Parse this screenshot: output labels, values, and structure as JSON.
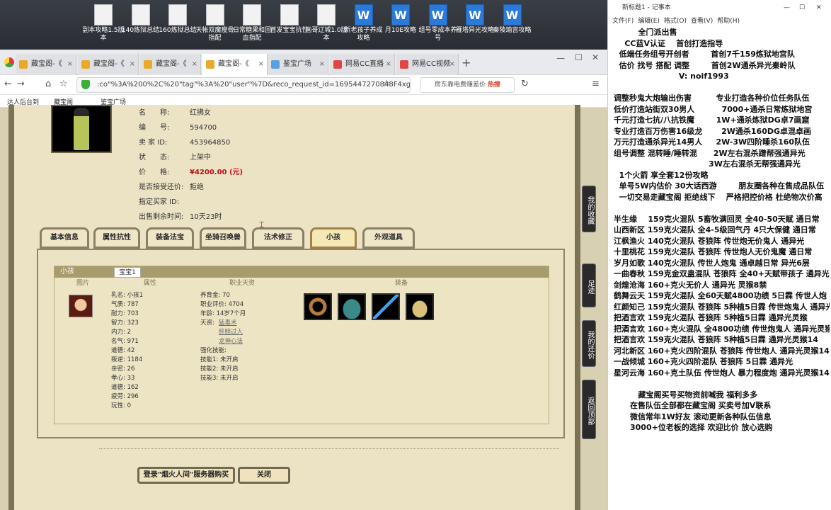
{
  "desktop": {
    "icons": [
      "副本攻略1.5版本",
      "140炼狱总结",
      "160炼狱总结",
      "天帐双魔瘦骨指配",
      "日常糖果和回血指配",
      "首发宝宝抗性",
      "画哥辽城1.0版本",
      "新老孩子养成攻略",
      "月10E攻略",
      "组号零成本养号",
      "雁塔异光攻略",
      "秦陵瑜宫攻略"
    ]
  },
  "browser": {
    "tabs": [
      {
        "label": "藏宝阁-《"
      },
      {
        "label": "藏宝阁-《"
      },
      {
        "label": "藏宝阁-《"
      },
      {
        "label": "藏宝阁-《"
      },
      {
        "label": "鉴宝广场"
      },
      {
        "label": "网易CC直播"
      },
      {
        "label": "网易CC视频"
      }
    ],
    "url": ":co\"%3A%200%2C%20\"tag\"%3A%20\"user\"%7D&reco_request_id=1695447270848F4xg6",
    "search_text": "房东靠电费赚差价",
    "search_hot": "热搜",
    "bookmarks": [
      "达人后台到",
      "藏宝阁",
      "鉴宝广场"
    ]
  },
  "detail": {
    "rows": [
      {
        "k": "名　　称:",
        "v": "红拂女"
      },
      {
        "k": "编　　号:",
        "v": "594700"
      },
      {
        "k": "卖 家 ID:",
        "v": "453964850"
      },
      {
        "k": "状　　态:",
        "v": "上架中"
      },
      {
        "k": "价　　格:",
        "v": "¥4200.00 (元)"
      },
      {
        "k": "是否接受还价:",
        "v": "拒绝"
      },
      {
        "k": "指定买家 ID:",
        "v": ""
      },
      {
        "k": "出售剩余时间:",
        "v": "10天23时"
      }
    ]
  },
  "tabs": [
    "基本信息",
    "属性抗性",
    "装备法宝",
    "坐骑召唤兽",
    "法术修正",
    "小孩",
    "外观道具"
  ],
  "child": {
    "head": "小孩",
    "subtab": "宝宝1",
    "cols": [
      "图片",
      "属性",
      "职业天资",
      "装备"
    ],
    "attrs": [
      "乳名: 小孩1",
      "气质: 787",
      "耐力: 703",
      "智力: 323",
      "内力: 2",
      "名气: 971",
      "道德: 42",
      "叛逆: 1184",
      "亲密: 26",
      "孝心: 33",
      "道德: 162",
      "疲劳: 296",
      "玩性: 0"
    ],
    "career": [
      "养育金: 70",
      "职业评价: 4704",
      "年龄: 14岁7个月",
      "天资:"
    ],
    "talents": [
      "猛毒术",
      "肝胆过人",
      "龙神心法"
    ],
    "skills": [
      "强化技能:",
      "技能1: 未开启",
      "技能2: 未开启",
      "技能3: 未开启"
    ]
  },
  "buttons": {
    "buy": "登录\"烟火人间\"服务器购买",
    "close": "关闭"
  },
  "side": [
    "我的收藏",
    "足迹",
    "我的还价",
    "返回顶部"
  ],
  "notepad": {
    "title": "新标题1 - 记事本",
    "menu": [
      "文件(F)",
      "编辑(E)",
      "格式(O)",
      "查看(V)",
      "帮助(H)"
    ],
    "lines": [
      "         全门派出售",
      "    CC蓝V认证    首创打造指导",
      "  低端任务组号开创者        首创7千159炼狱地宫队",
      "  估价 找号 搭配 调整        首创2W通杀异光秦岭队",
      "                        V: noif1993",
      "",
      "调整秒鬼大炮输出伤害         专业打造各种价位任务队伍",
      "低价打造站街双30男人          7000+通杀日常炼狱地宫",
      "千元打造七抗/八抗铁魔        1W+通杀炼狱DG卓7画窟",
      "专业打造百万伤害16级龙       2W通杀160DG卓混卓画",
      "万元打造通杀异光14男人     2W-3W四阶睡杀160队伍",
      "组号调整 混转睡/睡转混      2W左右混杀蹭帮强通异光",
      "                                   3W左右混杀无帮强通异光",
      "  1个火箭 享全套12份攻略",
      "  单号5W内估价 30大话西游        朋友圈各种在售成品队伍",
      "  一切交易走藏宝阁 拒绝线下    严格把控价格 杜绝物次价高",
      "",
      "半生缘    159克火混队 5畜牧满回灵 全40-50天赋 通日常",
      "山西新区 159克火混队 全4-5级回气丹 4只大保健 通日常",
      "江枫渔火 140克火混队 苍狼阵 传世炮无价鬼人 通异光",
      "十里桃花 159克火混队 苍狼阵 传世炮人无价鬼魔 通日常",
      "岁月如歌 140克火混队 传世人炮鬼 通卓越日常 异光6层",
      "一曲春秋 159克金双蛊混队 苍狼阵 全40+天赋带孩子 通异光",
      "剑煌沧海 160+克火无价人 通异光 灵猴8禁",
      "鹤舞云天 159克火混队 全60天赋4800功绩 5日霖 传世人炮",
      "红颜知己 159克火混队 苍狼阵 5种植5日霖 传世炮鬼人 通异光",
      "把酒言欢 159克火混队 苍狼阵 5种植5日霖 通异光灵猴",
      "把酒言欢 160+克火混队 全4800功绩 传世炮鬼人 通异光灵猴",
      "把酒言欢 159克火混队 苍狼阵 5种植5日霖 通异光灵猴14",
      "河北新区 160+克火四阶混队 苍狼阵 传世炮人 通异光灵猴14",
      "一战倾城 160+克火四阶混队 苍狼阵 5日霖 通异光",
      "星河云海 160+克土队伍 传世炮人 暴力程度炮 通异光灵猴14",
      "",
      "         藏宝阁买号买物资前喊我 福利多多",
      "      在售队伍全部都在藏宝阁 买卖号加V联系",
      "      微信常年1W好友 滚动更新各种队伍信息",
      "      3000+位老板的选择 欢迎比价 放心选购"
    ]
  }
}
